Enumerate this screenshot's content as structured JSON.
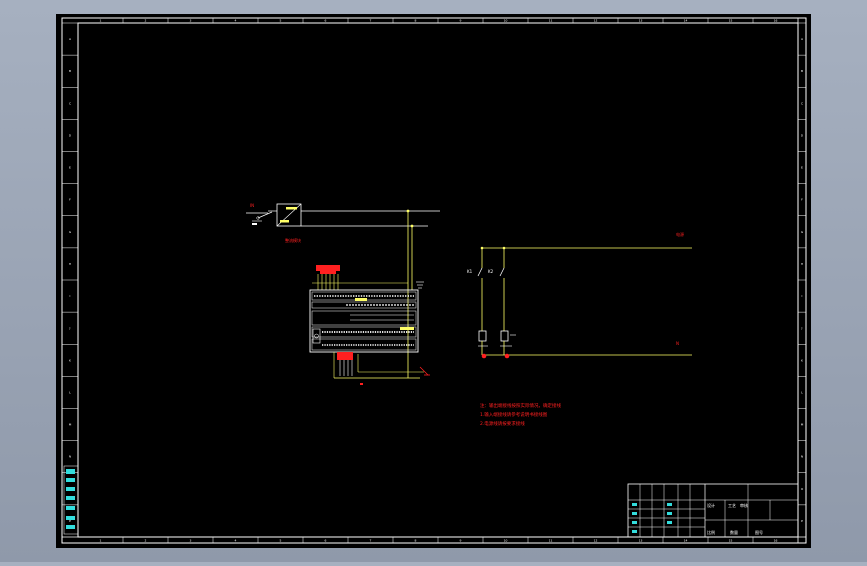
{
  "colors": {
    "background": "#000000",
    "frame": "#ffffff",
    "wire": "#ffff66",
    "annotation": "#ff2020",
    "title_block": "#ffffff",
    "cyan": "#33dddd"
  },
  "labels": {
    "left_supply": "IN",
    "left_converter": "整流模块",
    "right_top": "电源",
    "right_bottom": "N",
    "switch_k1": "K1",
    "switch_k2": "K2"
  },
  "notes": [
    "注：输出端接线按照实际情况，确定接线",
    "1.输入端接线请参考说明书接线图",
    "2.电源线请按要求接线"
  ],
  "title_block": {
    "r1": [
      "设计",
      "工艺",
      "审核"
    ],
    "r2": [
      "比例",
      "数量",
      "图号"
    ]
  },
  "frame_ticks": {
    "top": [
      "1",
      "2",
      "3",
      "4",
      "5",
      "6",
      "7",
      "8",
      "9",
      "10",
      "11",
      "12",
      "13",
      "14",
      "15",
      "16"
    ],
    "left": [
      "A",
      "B",
      "C",
      "D",
      "E",
      "F",
      "G",
      "H",
      "I",
      "J",
      "K",
      "L",
      "M",
      "N",
      "O",
      "P"
    ]
  }
}
